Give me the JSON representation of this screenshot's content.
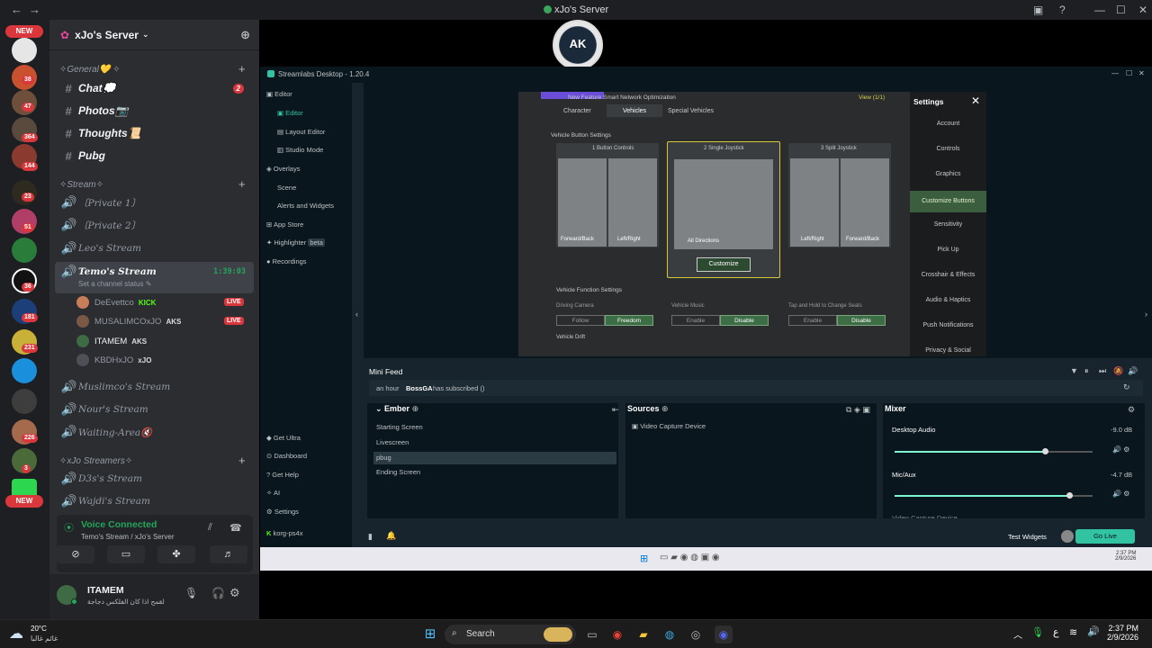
{
  "titlebar": {
    "title": "xJo's Server",
    "back": "←",
    "forward": "→"
  },
  "rail": {
    "new_label": "NEW",
    "badges": [
      "38",
      "47",
      "364",
      "144",
      "23",
      "51",
      "36",
      "181",
      "231",
      "226",
      "3"
    ],
    "new_label_bottom": "NEW"
  },
  "server": {
    "name": "xJo's Server"
  },
  "categories": {
    "general": "✧General💛 ✧",
    "stream": "✧Stream✧",
    "streamers": "✧xJo Streamers✧"
  },
  "text_channels": [
    {
      "name": "Chat💭",
      "badge": "2"
    },
    {
      "name": "Photos📷"
    },
    {
      "name": "Thoughts📜"
    },
    {
      "name": "Pubg"
    }
  ],
  "voice_channels": {
    "private1": "〔Private 1〕",
    "private2": "〔Private 2〕",
    "leo": "Leo's Stream",
    "temo": "Temo's Stream",
    "temo_timer": "1:39:03",
    "temo_status": "Set a channel status",
    "muslimco": "Muslimco's Stream",
    "nour": "Nour's Stream",
    "waiting": "Waiting-Area🔇",
    "d3s": "D3s's Stream",
    "wajdi": "Wajdi's Stream"
  },
  "members": [
    {
      "name": "DeEvettco",
      "tag": "KICK",
      "live": "LIVE"
    },
    {
      "name": "MUSALIMCOxJO",
      "tag": "AKS",
      "live": "LIVE"
    },
    {
      "name": "ITAMEM",
      "tag": "AKS"
    },
    {
      "name": "KBDHxJO",
      "tag": "xJO"
    }
  ],
  "voice": {
    "status": "Voice Connected",
    "location": "Temo's Stream / xJo's Server"
  },
  "user": {
    "name": "ITAMEM",
    "status": "يشكي حبه القمح اذا كان الفلكس دجاجة..."
  },
  "logo": {
    "text": "AK"
  },
  "streamlabs": {
    "title": "Streamlabs Desktop - 1.20.4",
    "nav": {
      "editor": "Editor",
      "editor_sub": "Editor",
      "layout_editor": "Layout Editor",
      "studio_mode": "Studio Mode",
      "overlays": "Overlays",
      "scene": "Scene",
      "alerts": "Alerts and Widgets",
      "app_store": "App Store",
      "highlighter": "Highlighter",
      "beta": "beta",
      "recordings": "Recordings",
      "get_ultra": "Get Ultra",
      "dashboard": "Dashboard",
      "get_help": "Get Help",
      "ai": "AI",
      "settings": "Settings",
      "account": "korg-ps4x"
    },
    "minifeed": {
      "title": "Mini Feed",
      "time": "an hour",
      "user": "BossGA",
      "event": "has subscribed ()"
    },
    "scenes": {
      "title": "Ember",
      "items": [
        "Starting Screen",
        "Livescreen",
        "pbug",
        "Ending Screen"
      ]
    },
    "sources": {
      "title": "Sources",
      "items": [
        "Video Capture Device"
      ]
    },
    "mixer": {
      "title": "Mixer",
      "channels": [
        {
          "label": "Desktop Audio",
          "db": "-9.0 dB",
          "level": 0.76
        },
        {
          "label": "Mic/Aux",
          "db": "-4.7 dB",
          "level": 0.88
        }
      ],
      "partial_label": "Video Capture Device"
    },
    "test_widgets": "Test Widgets",
    "go_live": "Go Live"
  },
  "game": {
    "banner_text": "New Feature Smart Network Optimization",
    "view": "View (1/1)",
    "settings_title": "Settings",
    "tabs": [
      "Character",
      "Vehicles",
      "Special Vehicles"
    ],
    "section_button": "Vehicle Button Settings",
    "options": [
      {
        "num": "1",
        "label": "Button Controls",
        "left": "Forward/Back",
        "right": "Left/Right"
      },
      {
        "num": "2",
        "label": "Single Joystick",
        "center": "All Directions"
      },
      {
        "num": "3",
        "label": "Split Joystick",
        "left": "Left/Right",
        "right": "Forward/Back"
      }
    ],
    "customize": "Customize",
    "section_function": "Vehicle Function Settings",
    "driving_camera": {
      "label": "Driving Camera",
      "off": "Follow",
      "on": "Freedom"
    },
    "vehicle_music": {
      "label": "Vehicle Music",
      "off": "Enable",
      "on": "Disable"
    },
    "tap_hold": {
      "label": "Tap and Hold to Change Seats",
      "off": "Enable",
      "on": "Disable"
    },
    "vehicle_drift": "Vehicle Drift",
    "side_menu": [
      "Account",
      "Controls",
      "Graphics",
      "Customize Buttons",
      "Sensitivity",
      "Pick Up",
      "Crosshair & Effects",
      "Audio & Haptics",
      "Push Notifications",
      "Privacy & Social"
    ]
  },
  "inner_clock": {
    "time": "2:37 PM",
    "date": "2/9/2026"
  },
  "taskbar": {
    "weather_temp": "20°C",
    "weather_desc": "غائم غالبا",
    "search": "Search",
    "time": "2:37 PM",
    "date": "2/9/2026",
    "lang": "ع"
  }
}
